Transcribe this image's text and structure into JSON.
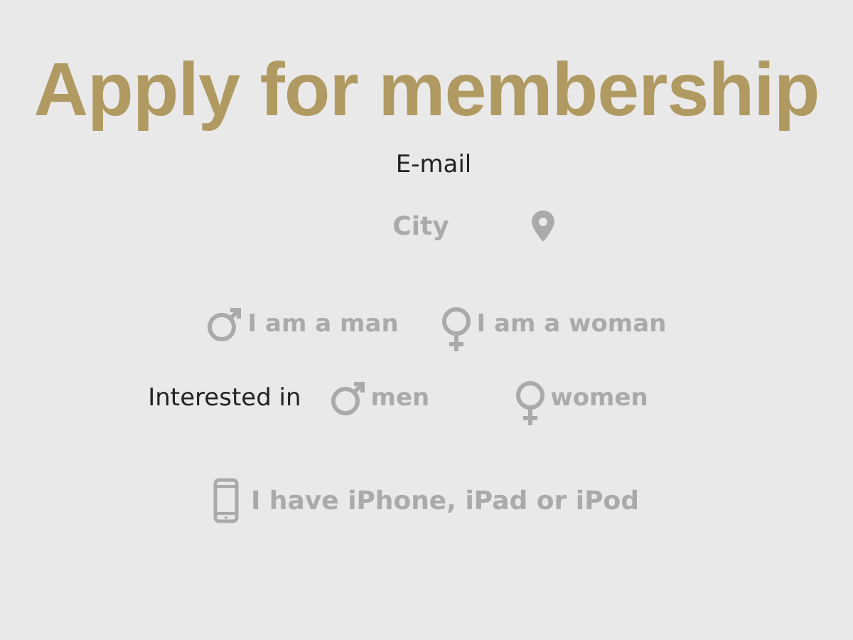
{
  "title": "Apply for membership",
  "email": {
    "label": "E-mail"
  },
  "city": {
    "placeholder": "City"
  },
  "gender": [
    {
      "kind": "male",
      "label": "I am a man",
      "selected": false
    },
    {
      "kind": "female",
      "label": "I am a woman",
      "selected": false
    }
  ],
  "interested_in": {
    "label": "Interested in",
    "options": [
      {
        "kind": "male",
        "label": "men",
        "selected": false
      },
      {
        "kind": "female",
        "label": "women",
        "selected": false
      }
    ]
  },
  "device": {
    "label": "I have iPhone, iPad or iPod",
    "checked": false
  }
}
